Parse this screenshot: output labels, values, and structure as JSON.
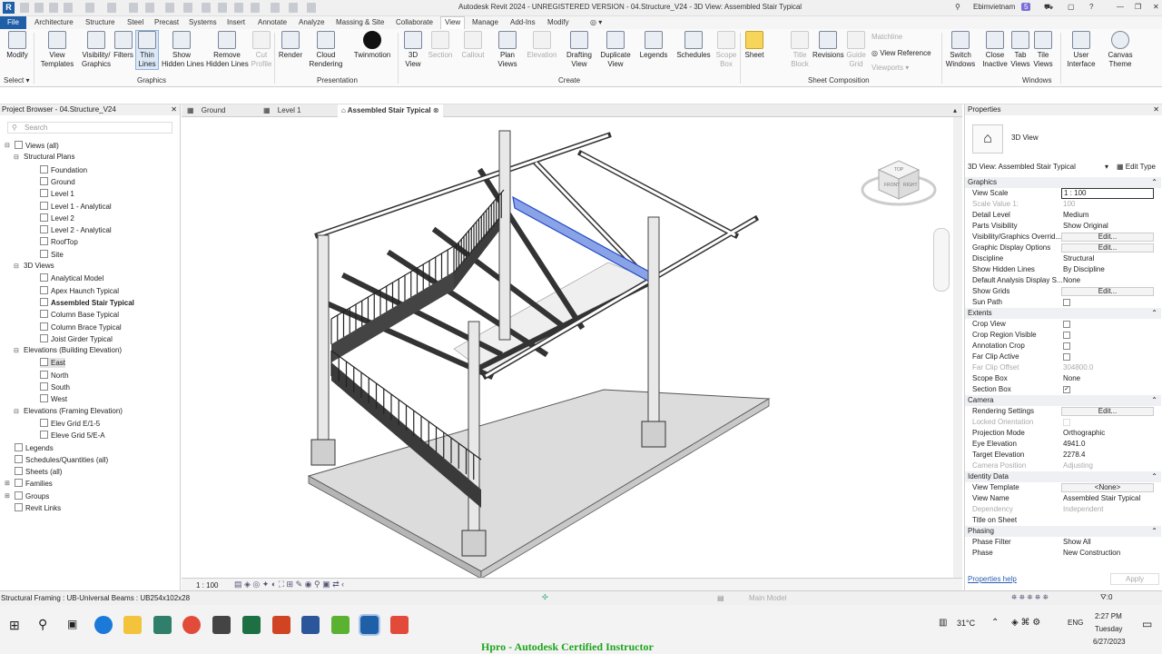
{
  "app": {
    "title": "Autodesk Revit 2024 - UNREGISTERED VERSION - 04.Structure_V24 - 3D View: Assembled Stair Typical",
    "user": "Ebimvietnam",
    "notifications": "5"
  },
  "menu": {
    "file": "File",
    "tabs": [
      "Architecture",
      "Structure",
      "Steel",
      "Precast",
      "Systems",
      "Insert",
      "Annotate",
      "Analyze",
      "Massing & Site",
      "Collaborate",
      "View",
      "Manage",
      "Add-Ins",
      "Modify"
    ],
    "active": "View"
  },
  "ribbon": {
    "buttons": [
      {
        "l1": "Modify",
        "l2": ""
      },
      {
        "l1": "View",
        "l2": "Templates"
      },
      {
        "l1": "Visibility/",
        "l2": "Graphics"
      },
      {
        "l1": "Filters",
        "l2": ""
      },
      {
        "l1": "Thin",
        "l2": "Lines"
      },
      {
        "l1": "Show",
        "l2": "Hidden Lines"
      },
      {
        "l1": "Remove",
        "l2": "Hidden Lines"
      },
      {
        "l1": "Cut",
        "l2": "Profile"
      },
      {
        "l1": "Render",
        "l2": ""
      },
      {
        "l1": "Cloud",
        "l2": "Rendering"
      },
      {
        "l1": "Twinmotion",
        "l2": ""
      },
      {
        "l1": "3D",
        "l2": "View"
      },
      {
        "l1": "Section",
        "l2": ""
      },
      {
        "l1": "Callout",
        "l2": ""
      },
      {
        "l1": "Plan",
        "l2": "Views"
      },
      {
        "l1": "Elevation",
        "l2": ""
      },
      {
        "l1": "Drafting",
        "l2": "View"
      },
      {
        "l1": "Duplicate",
        "l2": "View"
      },
      {
        "l1": "Legends",
        "l2": ""
      },
      {
        "l1": "Schedules",
        "l2": ""
      },
      {
        "l1": "Scope",
        "l2": "Box"
      },
      {
        "l1": "Sheet",
        "l2": ""
      },
      {
        "l1": "Title",
        "l2": "Block"
      },
      {
        "l1": "Revisions",
        "l2": ""
      },
      {
        "l1": "Guide",
        "l2": "Grid"
      },
      {
        "l1": "Switch",
        "l2": "Windows"
      },
      {
        "l1": "Close",
        "l2": "Inactive"
      },
      {
        "l1": "Tab",
        "l2": "Views"
      },
      {
        "l1": "Tile",
        "l2": "Views"
      },
      {
        "l1": "User",
        "l2": "Interface"
      },
      {
        "l1": "Canvas",
        "l2": "Theme"
      }
    ],
    "small": [
      "Matchline",
      "View Reference",
      "Viewports"
    ],
    "groups": [
      "Select",
      "Graphics",
      "Presentation",
      "Create",
      "Sheet Composition",
      "Windows"
    ]
  },
  "browser": {
    "title": "Project Browser - 04.Structure_V24",
    "search": "Search",
    "items": [
      "Views (all)",
      "Structural Plans",
      "Foundation",
      "Ground",
      "Level 1",
      "Level 1 - Analytical",
      "Level 2",
      "Level 2 - Analytical",
      "RoofTop",
      "Site",
      "3D Views",
      "Analytical Model",
      "Apex Haunch Typical",
      "Assembled Stair Typical",
      "Column Base Typical",
      "Column Brace Typical",
      "Joist Girder Typical",
      "Elevations (Building Elevation)",
      "East",
      "North",
      "South",
      "West",
      "Elevations (Framing Elevation)",
      "Elev Grid E/1-5",
      "Eleve Grid 5/E-A",
      "Legends",
      "Schedules/Quantities (all)",
      "Sheets (all)",
      "Families",
      "Groups",
      "Revit Links"
    ]
  },
  "doctabs": [
    "Ground",
    "Level 1",
    "Assembled Stair Typical"
  ],
  "viewcube": {
    "front": "FRONT",
    "right": "RIGHT",
    "top": "TOP"
  },
  "viewbar": {
    "scale": "1 : 100"
  },
  "props": {
    "title": "Properties",
    "type": "3D View",
    "selector": "3D View: Assembled Stair Typical",
    "edit_type": "Edit Type",
    "help": "Properties help",
    "apply": "Apply",
    "rows": [
      {
        "k": "Graphics",
        "v": "",
        "kind": "section"
      },
      {
        "k": "View Scale",
        "v": "1 : 100",
        "kind": "input"
      },
      {
        "k": "Scale Value  1:",
        "v": "100",
        "kind": "gray"
      },
      {
        "k": "Detail Level",
        "v": "Medium"
      },
      {
        "k": "Parts Visibility",
        "v": "Show Original"
      },
      {
        "k": "Visibility/Graphics Overrid...",
        "v": "Edit...",
        "kind": "btn"
      },
      {
        "k": "Graphic Display Options",
        "v": "Edit...",
        "kind": "btn"
      },
      {
        "k": "Discipline",
        "v": "Structural"
      },
      {
        "k": "Show Hidden Lines",
        "v": "By Discipline"
      },
      {
        "k": "Default Analysis Display S...",
        "v": "None"
      },
      {
        "k": "Show Grids",
        "v": "Edit...",
        "kind": "btn"
      },
      {
        "k": "Sun Path",
        "v": "",
        "kind": "cb"
      },
      {
        "k": "Extents",
        "v": "",
        "kind": "section"
      },
      {
        "k": "Crop View",
        "v": "",
        "kind": "cb"
      },
      {
        "k": "Crop Region Visible",
        "v": "",
        "kind": "cb"
      },
      {
        "k": "Annotation Crop",
        "v": "",
        "kind": "cb"
      },
      {
        "k": "Far Clip Active",
        "v": "",
        "kind": "cb"
      },
      {
        "k": "Far Clip Offset",
        "v": "304800.0",
        "kind": "gray"
      },
      {
        "k": "Scope Box",
        "v": "None"
      },
      {
        "k": "Section Box",
        "v": "✓",
        "kind": "cbx"
      },
      {
        "k": "Camera",
        "v": "",
        "kind": "section"
      },
      {
        "k": "Rendering Settings",
        "v": "Edit...",
        "kind": "btn"
      },
      {
        "k": "Locked Orientation",
        "v": "",
        "kind": "graycb"
      },
      {
        "k": "Projection Mode",
        "v": "Orthographic"
      },
      {
        "k": "Eye Elevation",
        "v": "4941.0"
      },
      {
        "k": "Target Elevation",
        "v": "2278.4"
      },
      {
        "k": "Camera Position",
        "v": "Adjusting",
        "kind": "gray"
      },
      {
        "k": "Identity Data",
        "v": "",
        "kind": "section"
      },
      {
        "k": "View Template",
        "v": "<None>",
        "kind": "btn"
      },
      {
        "k": "View Name",
        "v": "Assembled Stair Typical"
      },
      {
        "k": "Dependency",
        "v": "Independent",
        "kind": "gray"
      },
      {
        "k": "Title on Sheet",
        "v": ""
      },
      {
        "k": "Phasing",
        "v": "",
        "kind": "section"
      },
      {
        "k": "Phase Filter",
        "v": "Show All"
      },
      {
        "k": "Phase",
        "v": "New Construction"
      }
    ]
  },
  "status": {
    "text": "Structural Framing : UB-Universal Beams : UB254x102x28",
    "model": "Main Model",
    "sel_count": "0",
    "filter_count": "0"
  },
  "taskbar": {
    "weather": "31°C",
    "lang": "ENG",
    "time": "2:27 PM",
    "day": "Tuesday",
    "date": "6/27/2023"
  },
  "caption": "Hpro - Autodesk Certified Instructor"
}
